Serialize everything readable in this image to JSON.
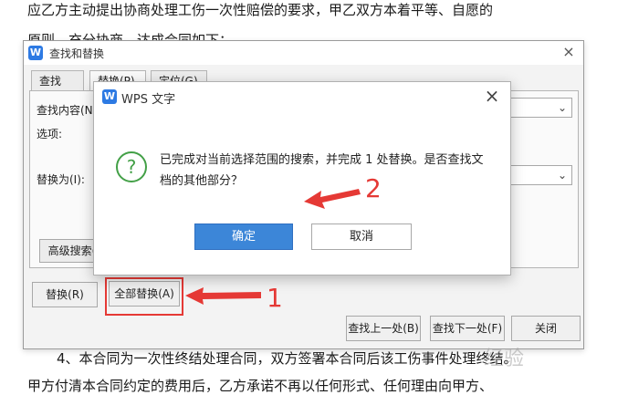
{
  "document": {
    "line1": "应乙方主动提出协商处理工伤一次性赔偿的要求，甲乙双方本着平等、自愿的",
    "line2": "原则，充分协商，达成合同如下：",
    "line3": "4、本合同为一次性终结处理合同，双方签署本合同后该工伤事件处理终结。",
    "line4": "甲方付清本合同约定的费用后，乙方承诺不再以任何形式、任何理由向甲方、"
  },
  "find_replace": {
    "logo": "W",
    "title": "查找和替换",
    "close_icon": "×",
    "tabs": [
      "查找(D)",
      "替换(P)",
      "定位(G)"
    ],
    "find_label": "查找内容(N",
    "options_label": "选项:",
    "replace_label": "替换为(I):",
    "advanced_btn": "高级搜索(",
    "replace_btn": "替换(R)",
    "replace_all_btn": "全部替换(A)",
    "find_prev_btn": "查找上一处(B)",
    "find_next_btn": "查找下一处(F)",
    "close_btn": "关闭",
    "chevron_icon": "⌄"
  },
  "message_box": {
    "logo": "W",
    "title": "WPS 文字",
    "close_icon": "×",
    "question_icon": "?",
    "text": "已完成对当前选择范围的搜索，并完成 1 处替换。是否查找文档的其他部分？",
    "ok_btn": "确定",
    "cancel_btn": "取消"
  },
  "annotations": {
    "step1": "1",
    "step2": "2",
    "color": "#e53935"
  },
  "watermark": "经验"
}
